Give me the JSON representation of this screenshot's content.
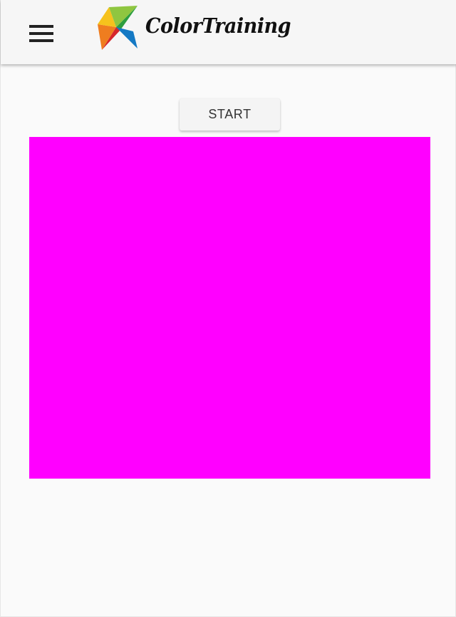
{
  "app_bar": {
    "brand": "ColorTraining",
    "menu_icon": "hamburger-menu-icon",
    "logo_icon": "multicolor-star-logo-icon"
  },
  "main": {
    "start_label": "START",
    "swatch_color": "#ff00ff"
  },
  "colors": {
    "app_bar_background": "#f6f6f6",
    "page_background": "#fafafa",
    "button_background": "#f4f4f4",
    "button_text": "#333333"
  }
}
